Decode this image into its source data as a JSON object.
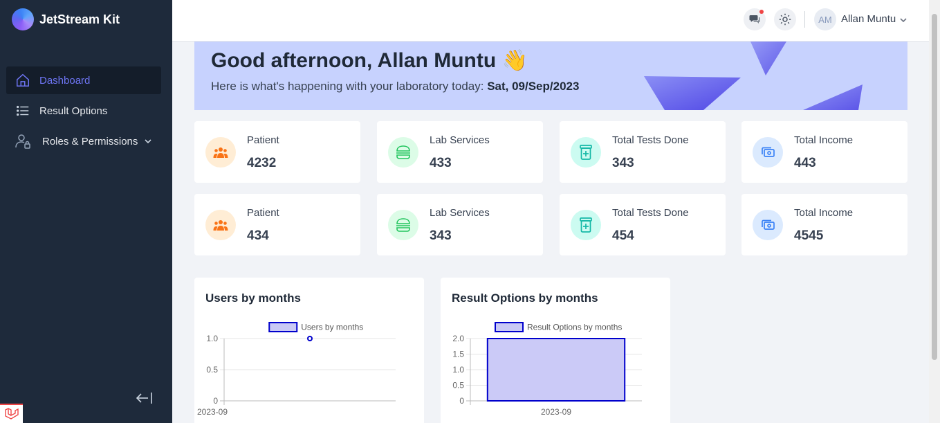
{
  "app": {
    "name": "JetStream Kit"
  },
  "sidebar": {
    "items": [
      {
        "label": "Dashboard",
        "icon": "home-icon",
        "active": true
      },
      {
        "label": "Result Options",
        "icon": "list-icon",
        "active": false
      },
      {
        "label": "Roles & Permissions",
        "icon": "user-lock-icon",
        "active": false
      }
    ]
  },
  "topbar": {
    "user_initials": "AM",
    "user_name": "Allan Muntu",
    "notification_color": "#ef4444"
  },
  "banner": {
    "greeting": "Good afternoon, Allan Muntu 👋",
    "subtitle_prefix": "Here is what's happening with your laboratory today: ",
    "date": "Sat, 09/Sep/2023"
  },
  "stats": [
    {
      "label": "Patient",
      "value": "4232",
      "icon": "users-icon",
      "color": "#f97316",
      "bg": "#ffedd5"
    },
    {
      "label": "Lab Services",
      "value": "433",
      "icon": "burger-icon",
      "color": "#22c55e",
      "bg": "#dcfce7"
    },
    {
      "label": "Total Tests Done",
      "value": "343",
      "icon": "medicine-icon",
      "color": "#14b8a6",
      "bg": "#ccfbf1"
    },
    {
      "label": "Total Income",
      "value": "443",
      "icon": "money-icon",
      "color": "#3b82f6",
      "bg": "#dbeafe"
    },
    {
      "label": "Patient",
      "value": "434",
      "icon": "users-icon",
      "color": "#f97316",
      "bg": "#ffedd5"
    },
    {
      "label": "Lab Services",
      "value": "343",
      "icon": "burger-icon",
      "color": "#22c55e",
      "bg": "#dcfce7"
    },
    {
      "label": "Total Tests Done",
      "value": "454",
      "icon": "medicine-icon",
      "color": "#14b8a6",
      "bg": "#ccfbf1"
    },
    {
      "label": "Total Income",
      "value": "4545",
      "icon": "money-icon",
      "color": "#3b82f6",
      "bg": "#dbeafe"
    }
  ],
  "chart_data": [
    {
      "type": "line",
      "title": "Users by months",
      "categories": [
        "2023-09"
      ],
      "series": [
        {
          "name": "Users by months",
          "values": [
            1
          ]
        }
      ],
      "ylim": [
        0,
        1
      ],
      "yticks": [
        0,
        0.5,
        1.0
      ],
      "ytick_labels": [
        "0",
        "0.5",
        "1.0"
      ],
      "grid": true,
      "legend": "top",
      "color": "#0000cc"
    },
    {
      "type": "bar",
      "title": "Result Options by months",
      "categories": [
        "2023-09"
      ],
      "series": [
        {
          "name": "Result Options by months",
          "values": [
            2
          ]
        }
      ],
      "ylim": [
        0,
        2
      ],
      "yticks": [
        0,
        0.5,
        1.0,
        1.5,
        2.0
      ],
      "ytick_labels": [
        "0",
        "0.5",
        "1.0",
        "1.5",
        "2.0"
      ],
      "grid": true,
      "legend": "top",
      "color": "#0000cc"
    }
  ]
}
